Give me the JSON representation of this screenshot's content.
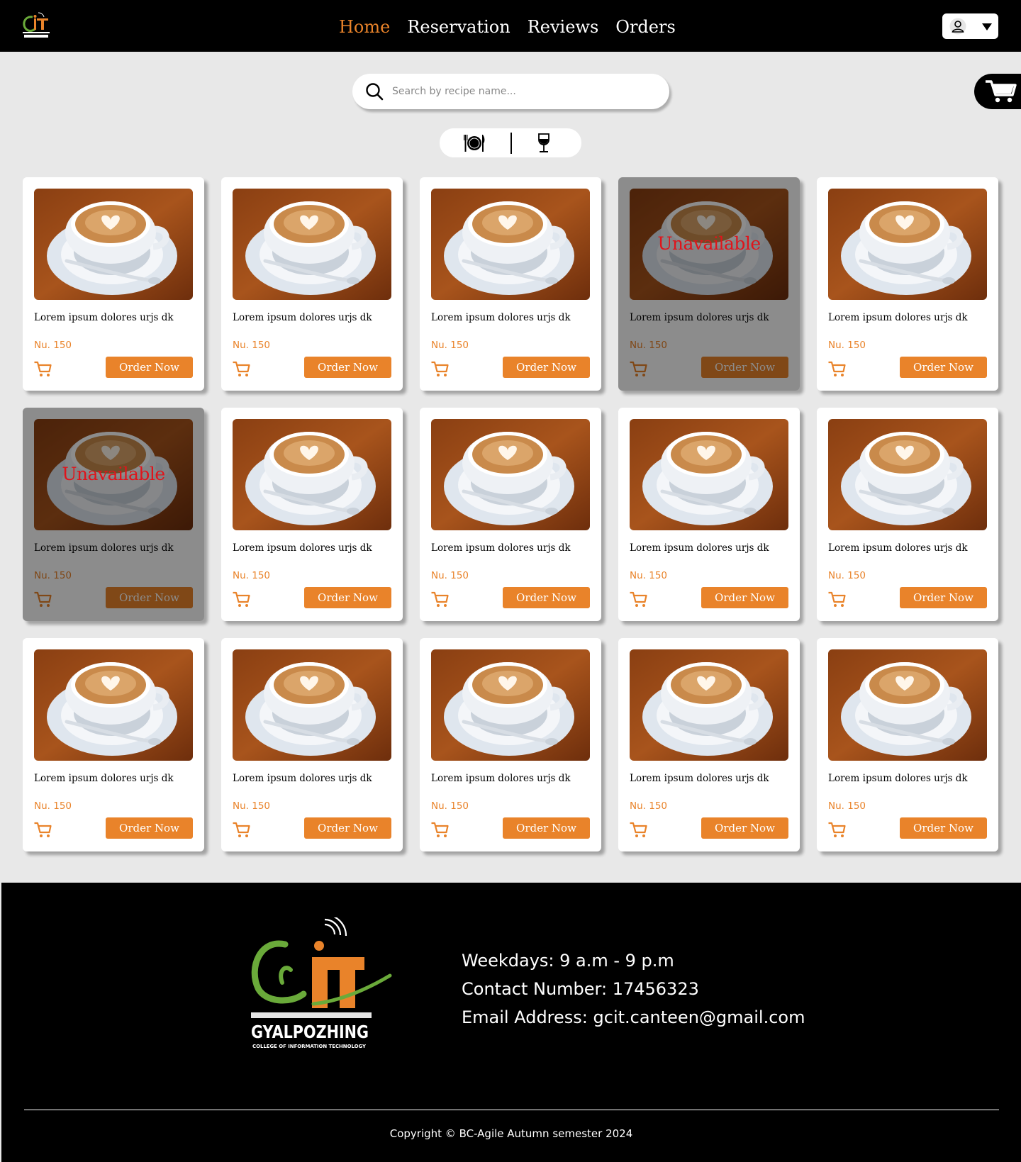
{
  "header": {
    "nav": [
      {
        "label": "Home",
        "active": true
      },
      {
        "label": "Reservation",
        "active": false
      },
      {
        "label": "Reviews",
        "active": false
      },
      {
        "label": "Orders",
        "active": false
      }
    ]
  },
  "search": {
    "placeholder": "Search by recipe name..."
  },
  "colors": {
    "accent": "#e9832a",
    "unavailable": "#e0141b",
    "header_bg": "#000000",
    "page_bg": "#e8e8e8"
  },
  "icons": {
    "logo": "gcit-logo",
    "user": "user-icon",
    "cart": "cart-icon",
    "food": "plate-cutlery-icon",
    "drink": "wine-glass-icon",
    "search": "search-icon"
  },
  "menu": {
    "items": [
      {
        "name": "Lorem ipsum dolores urjs dk",
        "price": "Nu. 150",
        "order_label": "Order Now",
        "unavailable": false
      },
      {
        "name": "Lorem ipsum dolores urjs dk",
        "price": "Nu. 150",
        "order_label": "Order Now",
        "unavailable": false
      },
      {
        "name": "Lorem ipsum dolores urjs dk",
        "price": "Nu. 150",
        "order_label": "Order Now",
        "unavailable": false
      },
      {
        "name": "Lorem ipsum dolores urjs dk",
        "price": "Nu. 150",
        "order_label": "Order Now",
        "unavailable": true,
        "unavailable_label": "Unavailable"
      },
      {
        "name": "Lorem ipsum dolores urjs dk",
        "price": "Nu. 150",
        "order_label": "Order Now",
        "unavailable": false
      },
      {
        "name": "Lorem ipsum dolores urjs dk",
        "price": "Nu. 150",
        "order_label": "Order Now",
        "unavailable": true,
        "unavailable_label": "Unavailable"
      },
      {
        "name": "Lorem ipsum dolores urjs dk",
        "price": "Nu. 150",
        "order_label": "Order Now",
        "unavailable": false
      },
      {
        "name": "Lorem ipsum dolores urjs dk",
        "price": "Nu. 150",
        "order_label": "Order Now",
        "unavailable": false
      },
      {
        "name": "Lorem ipsum dolores urjs dk",
        "price": "Nu. 150",
        "order_label": "Order Now",
        "unavailable": false
      },
      {
        "name": "Lorem ipsum dolores urjs dk",
        "price": "Nu. 150",
        "order_label": "Order Now",
        "unavailable": false
      },
      {
        "name": "Lorem ipsum dolores urjs dk",
        "price": "Nu. 150",
        "order_label": "Order Now",
        "unavailable": false
      },
      {
        "name": "Lorem ipsum dolores urjs dk",
        "price": "Nu. 150",
        "order_label": "Order Now",
        "unavailable": false
      },
      {
        "name": "Lorem ipsum dolores urjs dk",
        "price": "Nu. 150",
        "order_label": "Order Now",
        "unavailable": false
      },
      {
        "name": "Lorem ipsum dolores urjs dk",
        "price": "Nu. 150",
        "order_label": "Order Now",
        "unavailable": false
      },
      {
        "name": "Lorem ipsum dolores urjs dk",
        "price": "Nu. 150",
        "order_label": "Order Now",
        "unavailable": false
      }
    ]
  },
  "footer": {
    "logo_text": "GYALPOZHING",
    "logo_subtext": "COLLEGE OF INFORMATION TECHNOLOGY",
    "hours": "Weekdays: 9 a.m - 9 p.m",
    "contact": "Contact Number: 17456323",
    "email": "Email Address: gcit.canteen@gmail.com",
    "copyright": "Copyright © BC-Agile Autumn semester 2024"
  }
}
